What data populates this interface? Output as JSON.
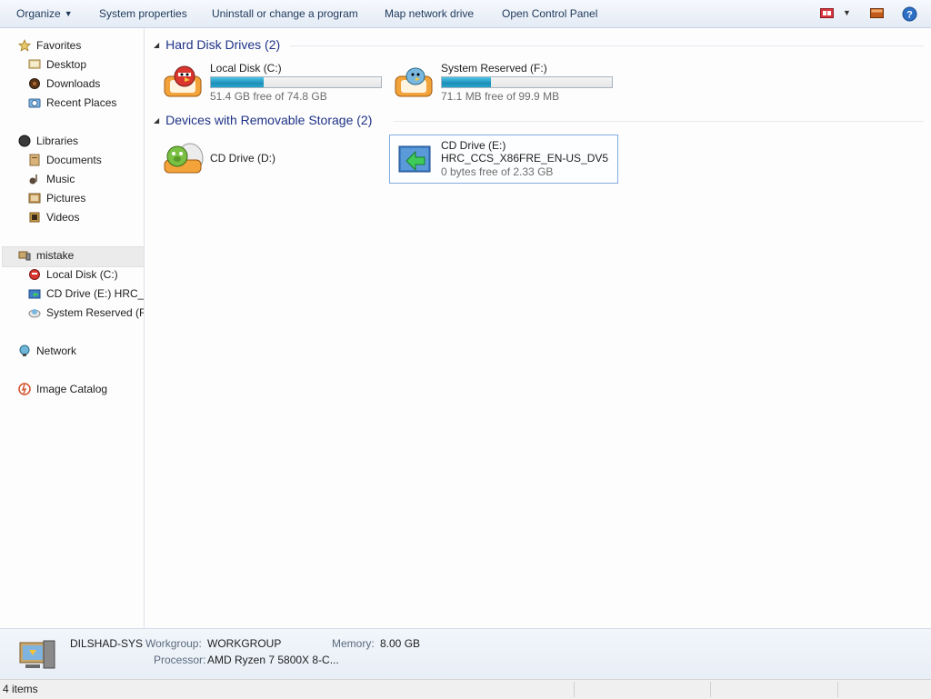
{
  "toolbar": {
    "organize": "Organize",
    "system_properties": "System properties",
    "uninstall": "Uninstall or change a program",
    "map_network": "Map network drive",
    "control_panel": "Open Control Panel",
    "icons": [
      "view-icon",
      "chevron-down-icon",
      "preview-pane-icon",
      "help-icon"
    ]
  },
  "nav": {
    "favorites": {
      "label": "Favorites",
      "items": [
        "Desktop",
        "Downloads",
        "Recent Places"
      ]
    },
    "libraries": {
      "label": "Libraries",
      "items": [
        "Documents",
        "Music",
        "Pictures",
        "Videos"
      ]
    },
    "computer": {
      "label": "mistake",
      "items": [
        "Local Disk (C:)",
        "CD Drive (E:) HRC_C",
        "System Reserved (F:)"
      ]
    },
    "network": "Network",
    "image_catalog": "Image Catalog"
  },
  "groups": {
    "hard_disks": {
      "header": "Hard Disk Drives (2)",
      "drives": [
        {
          "name": "Local Disk (C:)",
          "free": "51.4 GB free of 74.8 GB",
          "used_fraction": 0.31
        },
        {
          "name": "System Reserved (F:)",
          "free": "71.1 MB free of 99.9 MB",
          "used_fraction": 0.29
        }
      ]
    },
    "removable": {
      "header": "Devices with Removable Storage (2)",
      "drives": [
        {
          "name": "CD Drive (D:)"
        },
        {
          "name": "CD Drive (E:)",
          "label": "HRC_CCS_X86FRE_EN-US_DV5",
          "free": "0 bytes free of 2.33 GB"
        }
      ]
    }
  },
  "details": {
    "computer_name": "DILSHAD-SYS",
    "workgroup_label": "Workgroup:",
    "workgroup": "WORKGROUP",
    "memory_label": "Memory:",
    "memory": "8.00 GB",
    "processor_label": "Processor:",
    "processor": "AMD Ryzen 7 5800X 8-C..."
  },
  "status": {
    "items": "4 items"
  },
  "colors": {
    "accent": "#1e3287",
    "bar_fill": "#1c8fb8",
    "selection_border": "#84acdd"
  }
}
